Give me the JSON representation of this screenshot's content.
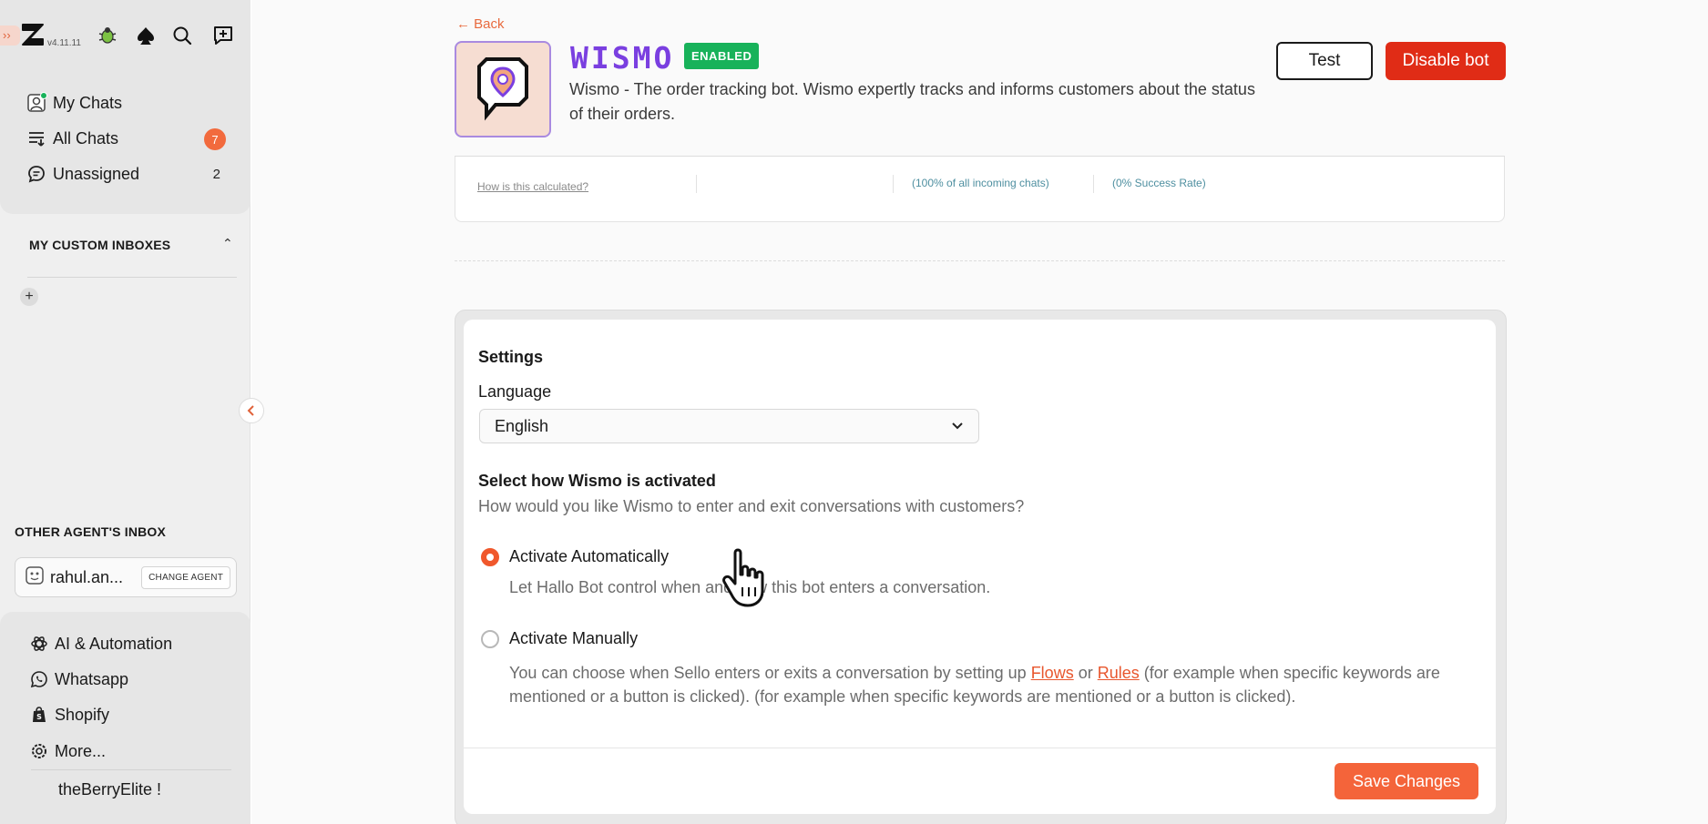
{
  "sidebar": {
    "version": "v4.11.11",
    "nav": [
      {
        "label": "My Chats",
        "icon": "avatar-chat-icon"
      },
      {
        "label": "All Chats",
        "icon": "list-filter-icon",
        "count": "7"
      },
      {
        "label": "Unassigned",
        "icon": "chat-bubble-icon",
        "count": "2"
      }
    ],
    "custom_inboxes_title": "MY CUSTOM INBOXES",
    "other_agents_title": "OTHER AGENT'S INBOX",
    "agent_name": "rahul.an...",
    "change_agent_label": "CHANGE AGENT",
    "links": [
      {
        "label": "AI & Automation",
        "icon": "openai-icon"
      },
      {
        "label": "Whatsapp",
        "icon": "whatsapp-icon"
      },
      {
        "label": "Shopify",
        "icon": "shopify-icon"
      },
      {
        "label": "More...",
        "icon": "gear-icon"
      }
    ],
    "user_name": "theBerryElite !"
  },
  "header": {
    "back_label": "← Back",
    "bot_name": "WISMO",
    "status_badge": "ENABLED",
    "description": "Wismo - The order tracking bot. Wismo expertly tracks and informs customers about the status of their orders.",
    "test_label": "Test",
    "disable_label": "Disable bot"
  },
  "stats": {
    "cut_1": "How is this calculated?",
    "cut_2": "(100% of all incoming chats)",
    "cut_3": "(0% Success Rate)"
  },
  "settings": {
    "title": "Settings",
    "language_label": "Language",
    "language_value": "English",
    "activation_title": "Select how Wismo is activated",
    "activation_subtitle": "How would you like Wismo to enter and exit conversations with customers?",
    "options": [
      {
        "label": "Activate Automatically",
        "description": "Let Hallo Bot control when and how this bot enters a conversation.",
        "selected": true
      },
      {
        "label": "Activate Manually",
        "description_pre": "You can choose when Sello enters or exits a conversation by setting up ",
        "link_flows": "Flows",
        "description_or": " or ",
        "link_rules": "Rules",
        "description_post": " (for example when specific keywords are mentioned or a button is clicked). (for example when specific keywords are mentioned or a button is clicked).",
        "selected": false
      }
    ],
    "save_label": "Save Changes"
  },
  "colors": {
    "accent": "#f4643a",
    "danger": "#e02c16",
    "success": "#18b25a",
    "bot_name": "#7a3fe0"
  }
}
